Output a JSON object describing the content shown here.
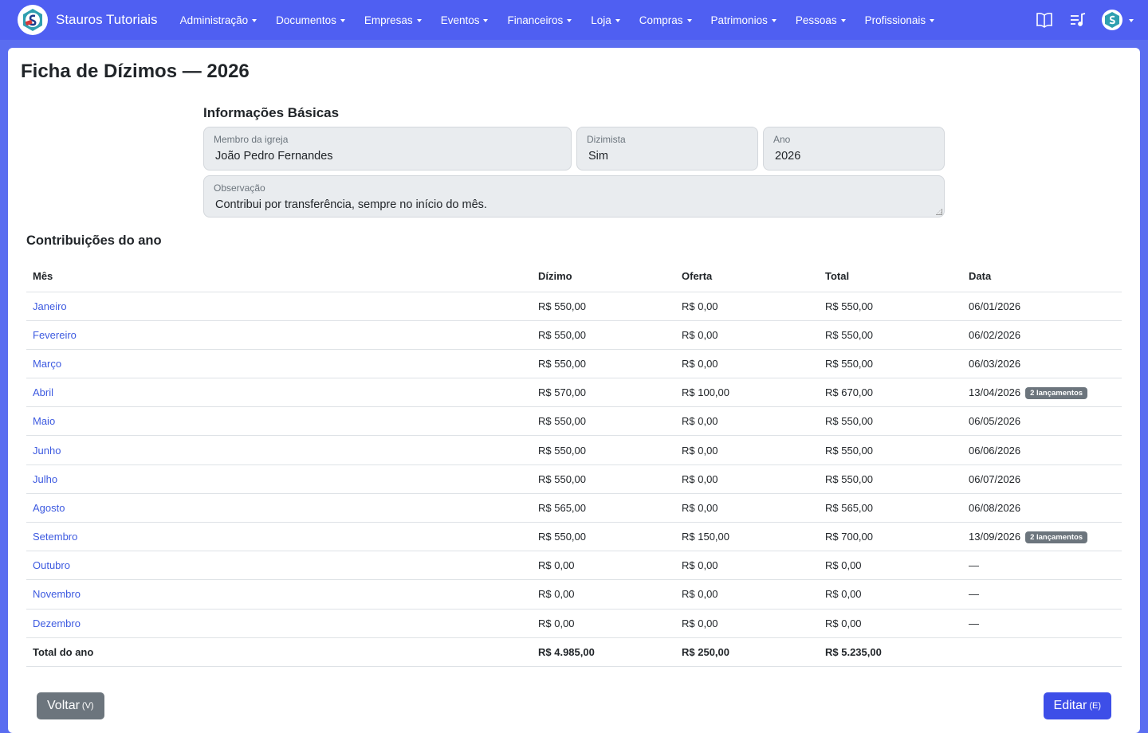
{
  "brand": {
    "name": "Stauros Tutoriais"
  },
  "nav": {
    "items": [
      {
        "key": "administracao",
        "label": "Administração"
      },
      {
        "key": "documentos",
        "label": "Documentos"
      },
      {
        "key": "empresas",
        "label": "Empresas"
      },
      {
        "key": "eventos",
        "label": "Eventos"
      },
      {
        "key": "financeiros",
        "label": "Financeiros"
      },
      {
        "key": "loja",
        "label": "Loja"
      },
      {
        "key": "compras",
        "label": "Compras"
      },
      {
        "key": "patrimonios",
        "label": "Patrimonios"
      },
      {
        "key": "pessoas",
        "label": "Pessoas"
      },
      {
        "key": "profissionais",
        "label": "Profissionais"
      }
    ],
    "right_icons": [
      "book-icon",
      "music-list-icon",
      "user-avatar-icon"
    ]
  },
  "page": {
    "title": "Ficha de Dízimos — 2026"
  },
  "basic_info": {
    "title": "Informações Básicas",
    "member_label": "Membro da igreja",
    "member_value": "João Pedro Fernandes",
    "tither_label": "Dizimista",
    "tither_value": "Sim",
    "year_label": "Ano",
    "year_value": "2026",
    "note_label": "Observação",
    "note_value": "Contribui por transferência, sempre no início do mês."
  },
  "contributions": {
    "title": "Contribuições do ano",
    "headers": {
      "month": "Mês",
      "tithe": "Dízimo",
      "offering": "Oferta",
      "total": "Total",
      "date": "Data"
    },
    "rows": [
      {
        "month": "Janeiro",
        "tithe": "R$ 550,00",
        "offering": "R$ 0,00",
        "total": "R$ 550,00",
        "date": "06/01/2026",
        "badge": ""
      },
      {
        "month": "Fevereiro",
        "tithe": "R$ 550,00",
        "offering": "R$ 0,00",
        "total": "R$ 550,00",
        "date": "06/02/2026",
        "badge": ""
      },
      {
        "month": "Março",
        "tithe": "R$ 550,00",
        "offering": "R$ 0,00",
        "total": "R$ 550,00",
        "date": "06/03/2026",
        "badge": ""
      },
      {
        "month": "Abril",
        "tithe": "R$ 570,00",
        "offering": "R$ 100,00",
        "total": "R$ 670,00",
        "date": "13/04/2026",
        "badge": "2 lançamentos"
      },
      {
        "month": "Maio",
        "tithe": "R$ 550,00",
        "offering": "R$ 0,00",
        "total": "R$ 550,00",
        "date": "06/05/2026",
        "badge": ""
      },
      {
        "month": "Junho",
        "tithe": "R$ 550,00",
        "offering": "R$ 0,00",
        "total": "R$ 550,00",
        "date": "06/06/2026",
        "badge": ""
      },
      {
        "month": "Julho",
        "tithe": "R$ 550,00",
        "offering": "R$ 0,00",
        "total": "R$ 550,00",
        "date": "06/07/2026",
        "badge": ""
      },
      {
        "month": "Agosto",
        "tithe": "R$ 565,00",
        "offering": "R$ 0,00",
        "total": "R$ 565,00",
        "date": "06/08/2026",
        "badge": ""
      },
      {
        "month": "Setembro",
        "tithe": "R$ 550,00",
        "offering": "R$ 150,00",
        "total": "R$ 700,00",
        "date": "13/09/2026",
        "badge": "2 lançamentos"
      },
      {
        "month": "Outubro",
        "tithe": "R$ 0,00",
        "offering": "R$ 0,00",
        "total": "R$ 0,00",
        "date": "—",
        "badge": ""
      },
      {
        "month": "Novembro",
        "tithe": "R$ 0,00",
        "offering": "R$ 0,00",
        "total": "R$ 0,00",
        "date": "—",
        "badge": ""
      },
      {
        "month": "Dezembro",
        "tithe": "R$ 0,00",
        "offering": "R$ 0,00",
        "total": "R$ 0,00",
        "date": "—",
        "badge": ""
      }
    ],
    "totals": {
      "label": "Total do ano",
      "tithe": "R$ 4.985,00",
      "offering": "R$ 250,00",
      "total": "R$ 5.235,00"
    }
  },
  "actions": {
    "back_label": "Voltar",
    "back_shortcut": "(V)",
    "edit_label": "Editar",
    "edit_shortcut": "(E)"
  },
  "colors": {
    "navbar": "#4f5ff2",
    "link": "#3d5ae0",
    "edit_button": "#3d4ee8",
    "back_button": "#6c757d"
  }
}
